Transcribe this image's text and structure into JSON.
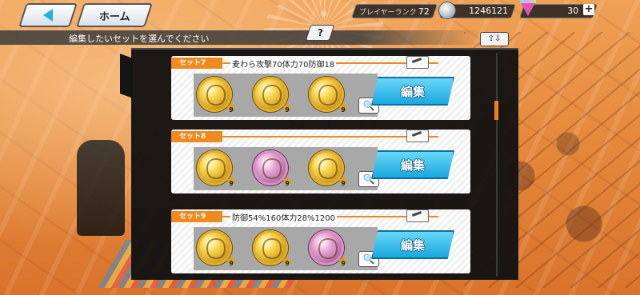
{
  "nav": {
    "back_label": "",
    "home_label": "ホーム"
  },
  "status": {
    "rank_label": "プレイヤーランク",
    "rank_value": "72",
    "coins": "1246121",
    "gems": "30",
    "gems_add": "+"
  },
  "instruction": "編集したいセットを選んでください",
  "help_label": "?",
  "sort_label": "⇧⇩",
  "colors": {
    "accent_orange": "#f08a1e",
    "edit_blue": "#19a8e0",
    "panel": "#121212"
  },
  "sets": [
    {
      "tag": "セット7",
      "description": "麦わら攻撃70体力70防御18",
      "medals": [
        {
          "type": "gold",
          "level": "9"
        },
        {
          "type": "gold",
          "level": "9"
        },
        {
          "type": "gold",
          "level": "9"
        }
      ],
      "edit_label": "編集"
    },
    {
      "tag": "セット8",
      "description": "",
      "medals": [
        {
          "type": "gold",
          "level": "9"
        },
        {
          "type": "pink",
          "level": "9"
        },
        {
          "type": "gold",
          "level": "9"
        }
      ],
      "edit_label": "編集"
    },
    {
      "tag": "セット9",
      "description": "防御54%160体力28%1200",
      "medals": [
        {
          "type": "gold",
          "level": "9"
        },
        {
          "type": "gold",
          "level": "9"
        },
        {
          "type": "pink",
          "level": "9"
        }
      ],
      "edit_label": "編集"
    }
  ]
}
